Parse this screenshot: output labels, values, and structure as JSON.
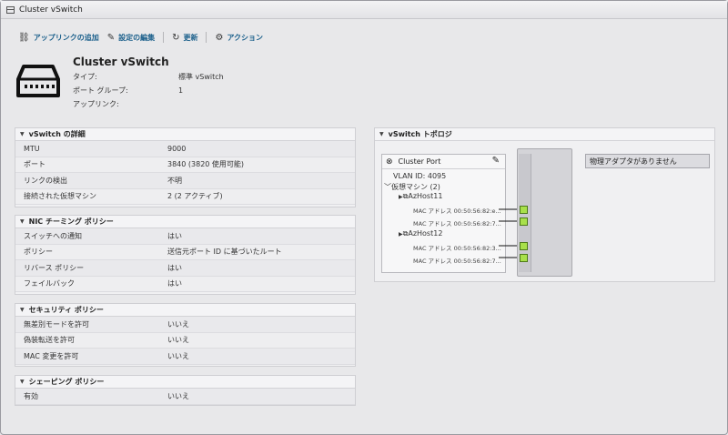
{
  "window": {
    "title": "Cluster vSwitch"
  },
  "toolbar": {
    "add_uplink": "アップリンクの追加",
    "edit_settings": "設定の編集",
    "refresh": "更新",
    "actions": "アクション"
  },
  "header": {
    "title": "Cluster vSwitch",
    "type_label": "タイプ:",
    "type_value": "標準 vSwitch",
    "portgroup_label": "ポート グループ:",
    "portgroup_value": "1",
    "uplink_label": "アップリンク:",
    "uplink_value": ""
  },
  "details": {
    "title": "vSwitch の詳細",
    "rows": [
      {
        "k": "MTU",
        "v": "9000"
      },
      {
        "k": "ポート",
        "v": "3840 (3820 使用可能)"
      },
      {
        "k": "リンクの検出",
        "v": "不明"
      },
      {
        "k": "接続された仮想マシン",
        "v": "2 (2 アクティブ)"
      }
    ]
  },
  "nic": {
    "title": "NIC チーミング ポリシー",
    "rows": [
      {
        "k": "スイッチへの通知",
        "v": "はい"
      },
      {
        "k": "ポリシー",
        "v": "送信元ポート ID に基づいたルート"
      },
      {
        "k": "リバース ポリシー",
        "v": "はい"
      },
      {
        "k": "フェイルバック",
        "v": "はい"
      }
    ]
  },
  "security": {
    "title": "セキュリティ ポリシー",
    "rows": [
      {
        "k": "無差別モードを許可",
        "v": "いいえ"
      },
      {
        "k": "偽装転送を許可",
        "v": "いいえ"
      },
      {
        "k": "MAC 変更を許可",
        "v": "いいえ"
      }
    ]
  },
  "shaping": {
    "title": "シェーピング ポリシー",
    "rows": [
      {
        "k": "有効",
        "v": "いいえ"
      }
    ]
  },
  "topology": {
    "title": "vSwitch トポロジ",
    "portgroup_name": "Cluster Port",
    "vlan": "VLAN ID: 4095",
    "vm_group": "仮想マシン (2)",
    "vm1": "AzHost11",
    "vm1_mac1": "MAC アドレス 00:50:56:82:e...",
    "vm1_mac2": "MAC アドレス 00:50:56:82:7...",
    "vm2": "AzHost12",
    "vm2_mac1": "MAC アドレス 00:50:56:82:3...",
    "vm2_mac2": "MAC アドレス 00:50:56:82:7...",
    "no_adapter": "物理アダプタがありません"
  },
  "colors": {
    "link": "#1a5f8b",
    "port": "#a8e04a"
  }
}
